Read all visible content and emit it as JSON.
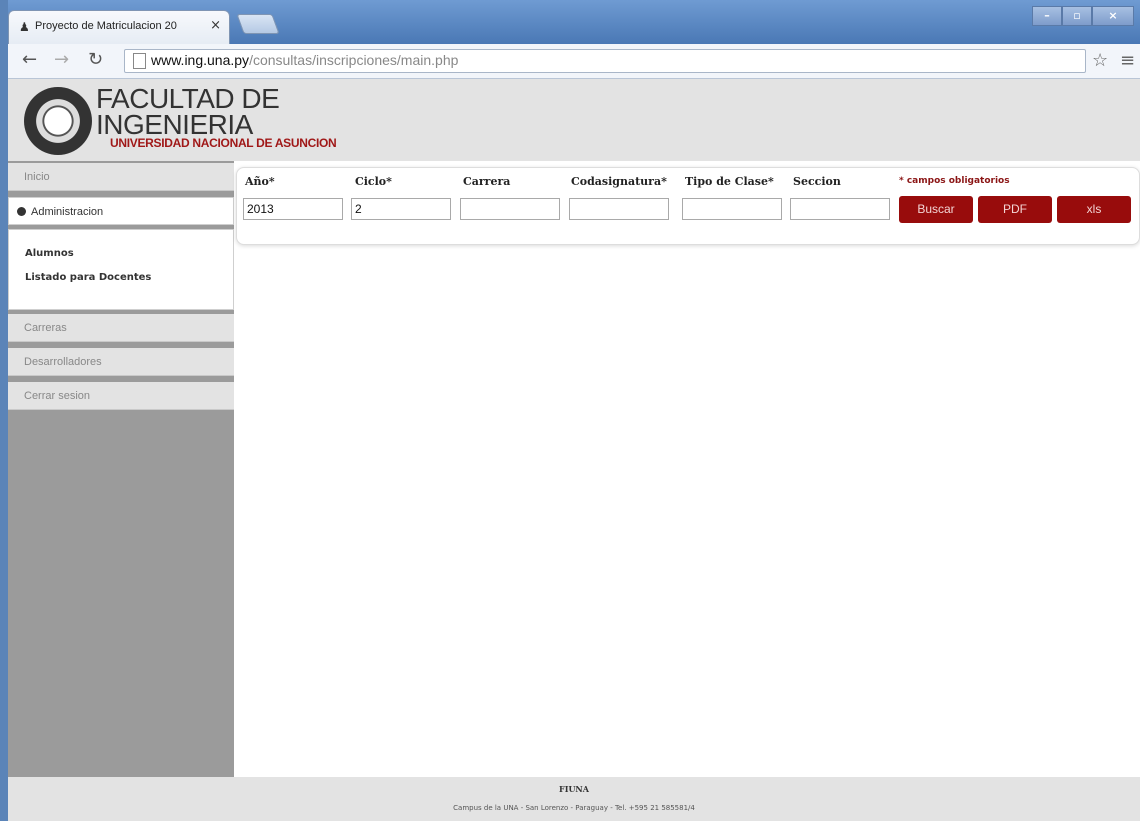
{
  "browser": {
    "tab_title": "Proyecto de Matriculacion 20",
    "tab_close": "×",
    "url_host": "www.ing.una.py",
    "url_path": "/consultas/inscripciones/main.php",
    "win_min": "–",
    "win_max": "▫",
    "win_close": "×"
  },
  "header": {
    "title_line1": "FACULTAD DE",
    "title_line2": "INGENIERIA",
    "subtitle": "UNIVERSIDAD NACIONAL DE ASUNCION"
  },
  "sidebar": {
    "items": [
      {
        "label": "Inicio"
      },
      {
        "label": "Administracion"
      },
      {
        "label": "Carreras"
      },
      {
        "label": "Desarrolladores"
      },
      {
        "label": "Cerrar sesion"
      }
    ],
    "submenu": [
      {
        "label": "Alumnos"
      },
      {
        "label": "Listado para Docentes"
      }
    ]
  },
  "form": {
    "labels": {
      "anio": "Año*",
      "ciclo": "Ciclo*",
      "carrera": "Carrera",
      "codasignatura": "Codasignatura*",
      "tipo_clase": "Tipo de Clase*",
      "seccion": "Seccion"
    },
    "required_note": "* campos obligatorios",
    "values": {
      "anio": "2013",
      "ciclo": "2",
      "carrera": "",
      "codasignatura": "",
      "tipo_clase": "",
      "seccion": ""
    },
    "buttons": {
      "buscar": "Buscar",
      "pdf": "PDF",
      "xls": "xls"
    }
  },
  "footer": {
    "title": "FIUNA",
    "address": "Campus de la UNA - San Lorenzo - Paraguay - Tel. +595 21 585581/4"
  },
  "colors": {
    "accent": "#980c0c",
    "sidebar_bg": "#9b9b9b",
    "header_bg": "#e3e3e3"
  }
}
